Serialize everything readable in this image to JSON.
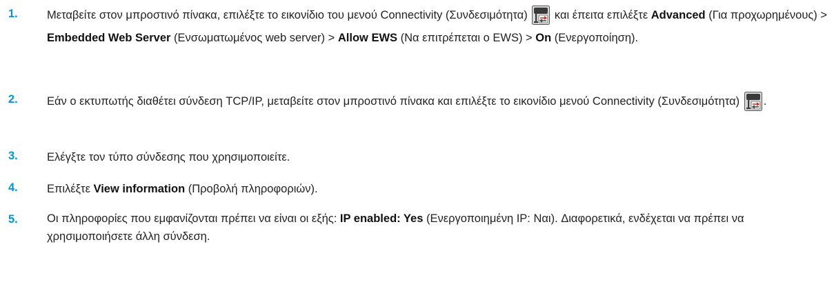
{
  "accent_color": "#0096d6",
  "icon": "connectivity-menu-icon",
  "steps": [
    {
      "number": "1.",
      "t1": "Μεταβείτε στον μπροστινό πίνακα, επιλέξτε το εικονίδιο του μενού Connectivity (Συνδεσιμότητα) ",
      "t2": " και έπειτα επιλέξτε ",
      "b1": "Advanced",
      "t3": " (Για προχωρημένους) > ",
      "b2": "Embedded Web Server",
      "t4": " (Ενσωματωμένος web server) > ",
      "b3": "Allow EWS",
      "t5": " (Να επιτρέπεται ο EWS) > ",
      "b4": "On",
      "t6": " (Ενεργοποίηση)."
    },
    {
      "number": "2.",
      "t1": "Εάν ο εκτυπωτής διαθέτει σύνδεση TCP/IP, μεταβείτε στον μπροστινό πίνακα και επιλέξτε το εικονίδιο μενού Connectivity (Συνδεσιμότητα) ",
      "t2": "."
    },
    {
      "number": "3.",
      "t1": "Ελέγξτε τον τύπο σύνδεσης που χρησιμοποιείτε."
    },
    {
      "number": "4.",
      "t1": "Επιλέξτε ",
      "b1": "View information",
      "t2": " (Προβολή πληροφοριών)."
    },
    {
      "number": "5.",
      "t1": "Οι πληροφορίες που εμφανίζονται πρέπει να είναι οι εξής: ",
      "b1": "IP enabled: Yes",
      "t2": " (Ενεργοποιημένη IP: Ναι). Διαφορετικά, ενδέχεται να πρέπει να χρησιμοποιήσετε άλλη σύνδεση."
    }
  ]
}
